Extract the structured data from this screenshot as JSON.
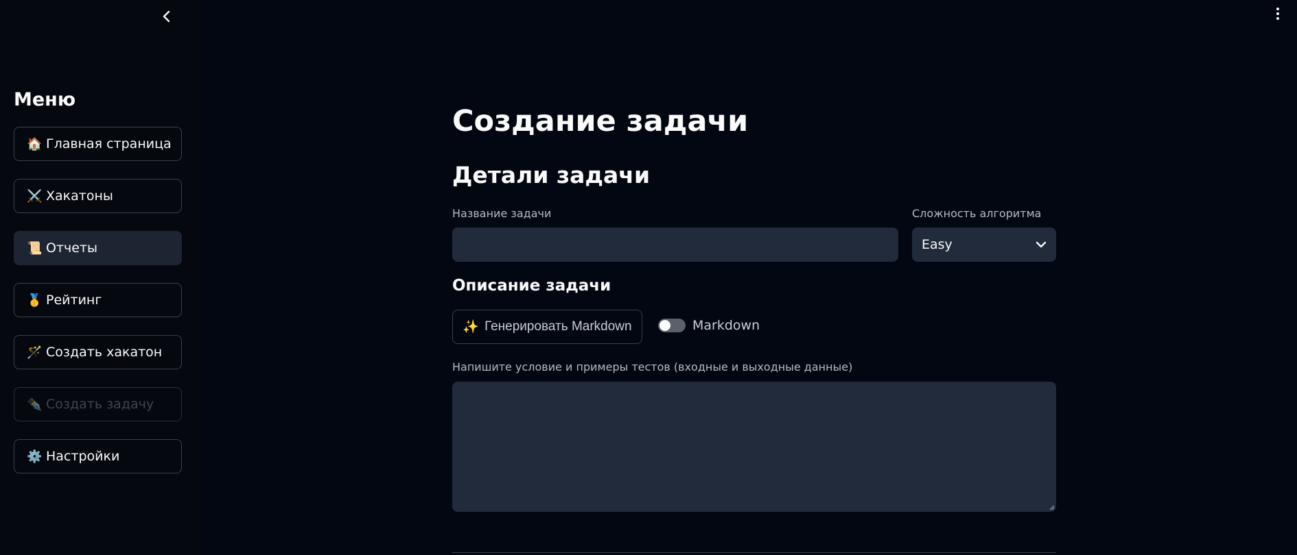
{
  "sidebar": {
    "menu_title": "Меню",
    "items": [
      {
        "emoji": "🏠",
        "label": "Главная страница"
      },
      {
        "emoji": "⚔️",
        "label": "Хакатоны"
      },
      {
        "emoji": "📜",
        "label": "Отчеты"
      },
      {
        "emoji": "🥇",
        "label": "Рейтинг"
      },
      {
        "emoji": "🪄",
        "label": "Создать хакатон"
      },
      {
        "emoji": "✒️",
        "label": "Создать задачу"
      },
      {
        "emoji": "⚙️",
        "label": "Настройки"
      }
    ]
  },
  "main": {
    "title": "Создание задачи",
    "details_heading": "Детали задачи",
    "task_name_label": "Название задачи",
    "task_name_value": "",
    "complexity_label": "Сложность алгоритма",
    "complexity_value": "Easy",
    "description_heading": "Описание задачи",
    "generate_button": {
      "emoji": "✨",
      "label": "Генерировать Markdown"
    },
    "markdown_toggle": {
      "label": "Markdown",
      "checked": false
    },
    "condition_label": "Напишите условие и примеры тестов (входные и выходные данные)",
    "condition_value": ""
  },
  "colors": {
    "background": "#030712",
    "sidebar": "#060810",
    "input": "#222b3b",
    "active_nav": "#1e2532"
  }
}
